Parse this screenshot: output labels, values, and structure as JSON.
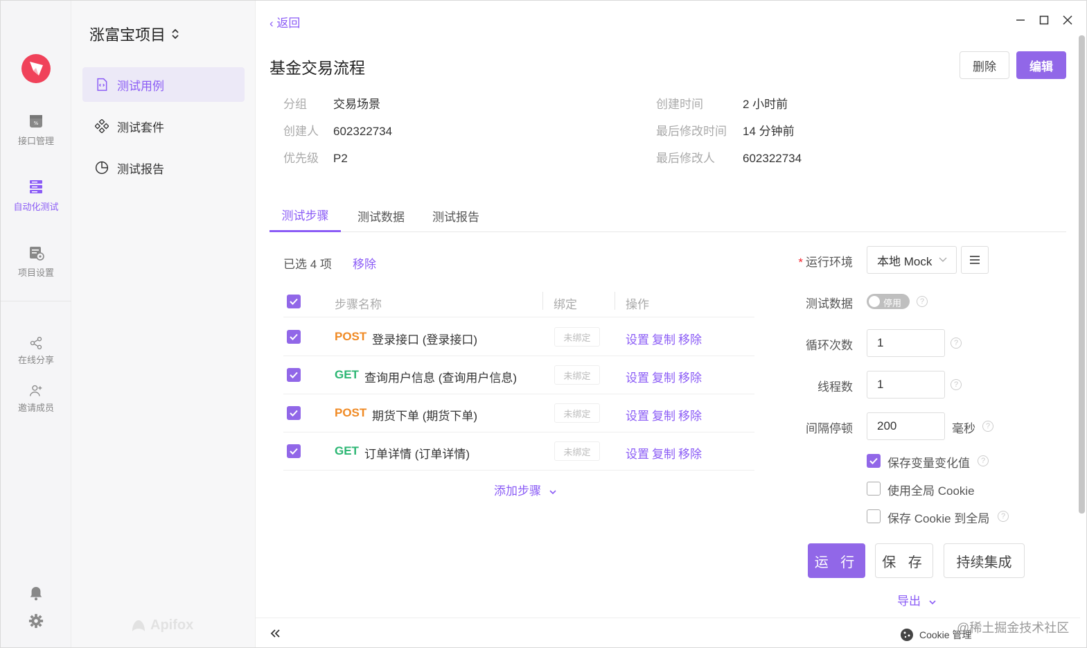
{
  "rail": {
    "items": [
      {
        "label": "接口管理",
        "icon": "api-icon"
      },
      {
        "label": "自动化测试",
        "icon": "automation-icon"
      },
      {
        "label": "项目设置",
        "icon": "project-settings-icon"
      },
      {
        "label": "在线分享",
        "icon": "share-icon"
      },
      {
        "label": "邀请成员",
        "icon": "invite-icon"
      }
    ],
    "active": "自动化测试"
  },
  "sidebar": {
    "project": "涨富宝项目",
    "items": [
      {
        "label": "测试用例",
        "icon": "test-case-icon"
      },
      {
        "label": "测试套件",
        "icon": "test-suite-icon"
      },
      {
        "label": "测试报告",
        "icon": "test-report-icon"
      }
    ],
    "brand": "Apifox"
  },
  "header": {
    "back": "返回",
    "title": "基金交易流程",
    "delete": "删除",
    "edit": "编辑"
  },
  "meta": {
    "group_k": "分组",
    "group_v": "交易场景",
    "creator_k": "创建人",
    "creator_v": "602322734",
    "priority_k": "优先级",
    "priority_v": "P2",
    "created_k": "创建时间",
    "created_v": "2 小时前",
    "modified_k": "最后修改时间",
    "modified_v": "14 分钟前",
    "modifier_k": "最后修改人",
    "modifier_v": "602322734"
  },
  "tabs": [
    "测试步骤",
    "测试数据",
    "测试报告"
  ],
  "steps": {
    "selected": "已选 4 项",
    "remove": "移除",
    "headers": {
      "name": "步骤名称",
      "bind": "绑定",
      "ops": "操作"
    },
    "rows": [
      {
        "method": "POST",
        "name": "登录接口 (登录接口)",
        "bind": "未绑定"
      },
      {
        "method": "GET",
        "name": "查询用户信息 (查询用户信息)",
        "bind": "未绑定"
      },
      {
        "method": "POST",
        "name": "期货下单 (期货下单)",
        "bind": "未绑定"
      },
      {
        "method": "GET",
        "name": "订单详情 (订单详情)",
        "bind": "未绑定"
      }
    ],
    "op_set": "设置",
    "op_copy": "复制",
    "op_remove": "移除",
    "add": "添加步骤"
  },
  "config": {
    "env_label": "运行环境",
    "env_value": "本地 Mock",
    "data_label": "测试数据",
    "data_toggle": "停用",
    "loop_label": "循环次数",
    "loop_value": "1",
    "thread_label": "线程数",
    "thread_value": "1",
    "interval_label": "间隔停顿",
    "interval_value": "200",
    "interval_unit": "毫秒",
    "opt1": "保存变量变化值",
    "opt1_checked": true,
    "opt2": "使用全局 Cookie",
    "opt2_checked": false,
    "opt3": "保存 Cookie 到全局",
    "opt3_checked": false,
    "run": "运 行",
    "save": "保 存",
    "ci": "持续集成",
    "export": "导出"
  },
  "bottom": {
    "cookie": "Cookie 管理",
    "credit": "@稀土掘金技术社区"
  },
  "colors": {
    "accent": "#8b5cf6",
    "post": "#f08a24",
    "get": "#2bb673"
  }
}
